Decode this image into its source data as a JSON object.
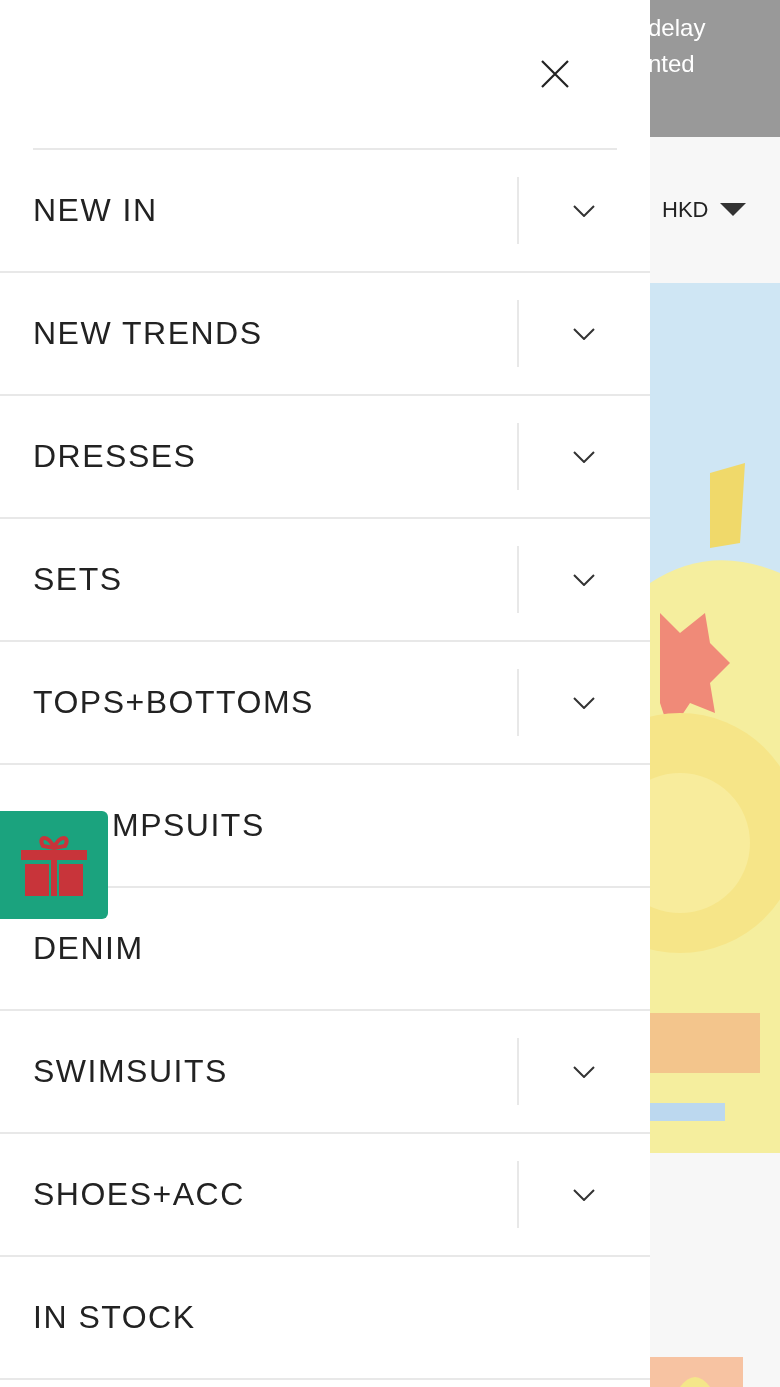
{
  "drawer": {
    "items": [
      {
        "label": "NEW IN",
        "expandable": true
      },
      {
        "label": "NEW TRENDS",
        "expandable": true
      },
      {
        "label": "DRESSES",
        "expandable": true
      },
      {
        "label": "SETS",
        "expandable": true
      },
      {
        "label": "TOPS+BOTTOMS",
        "expandable": true
      },
      {
        "label": "MPSUITS",
        "expandable": false,
        "kind": "covered"
      },
      {
        "label": "DENIM",
        "expandable": false
      },
      {
        "label": "SWIMSUITS",
        "expandable": true
      },
      {
        "label": "SHOES+ACC",
        "expandable": true
      },
      {
        "label": "IN STOCK",
        "expandable": false
      }
    ]
  },
  "page": {
    "notice_lines": [
      "delay",
      "nted"
    ],
    "currency": "HKD"
  }
}
